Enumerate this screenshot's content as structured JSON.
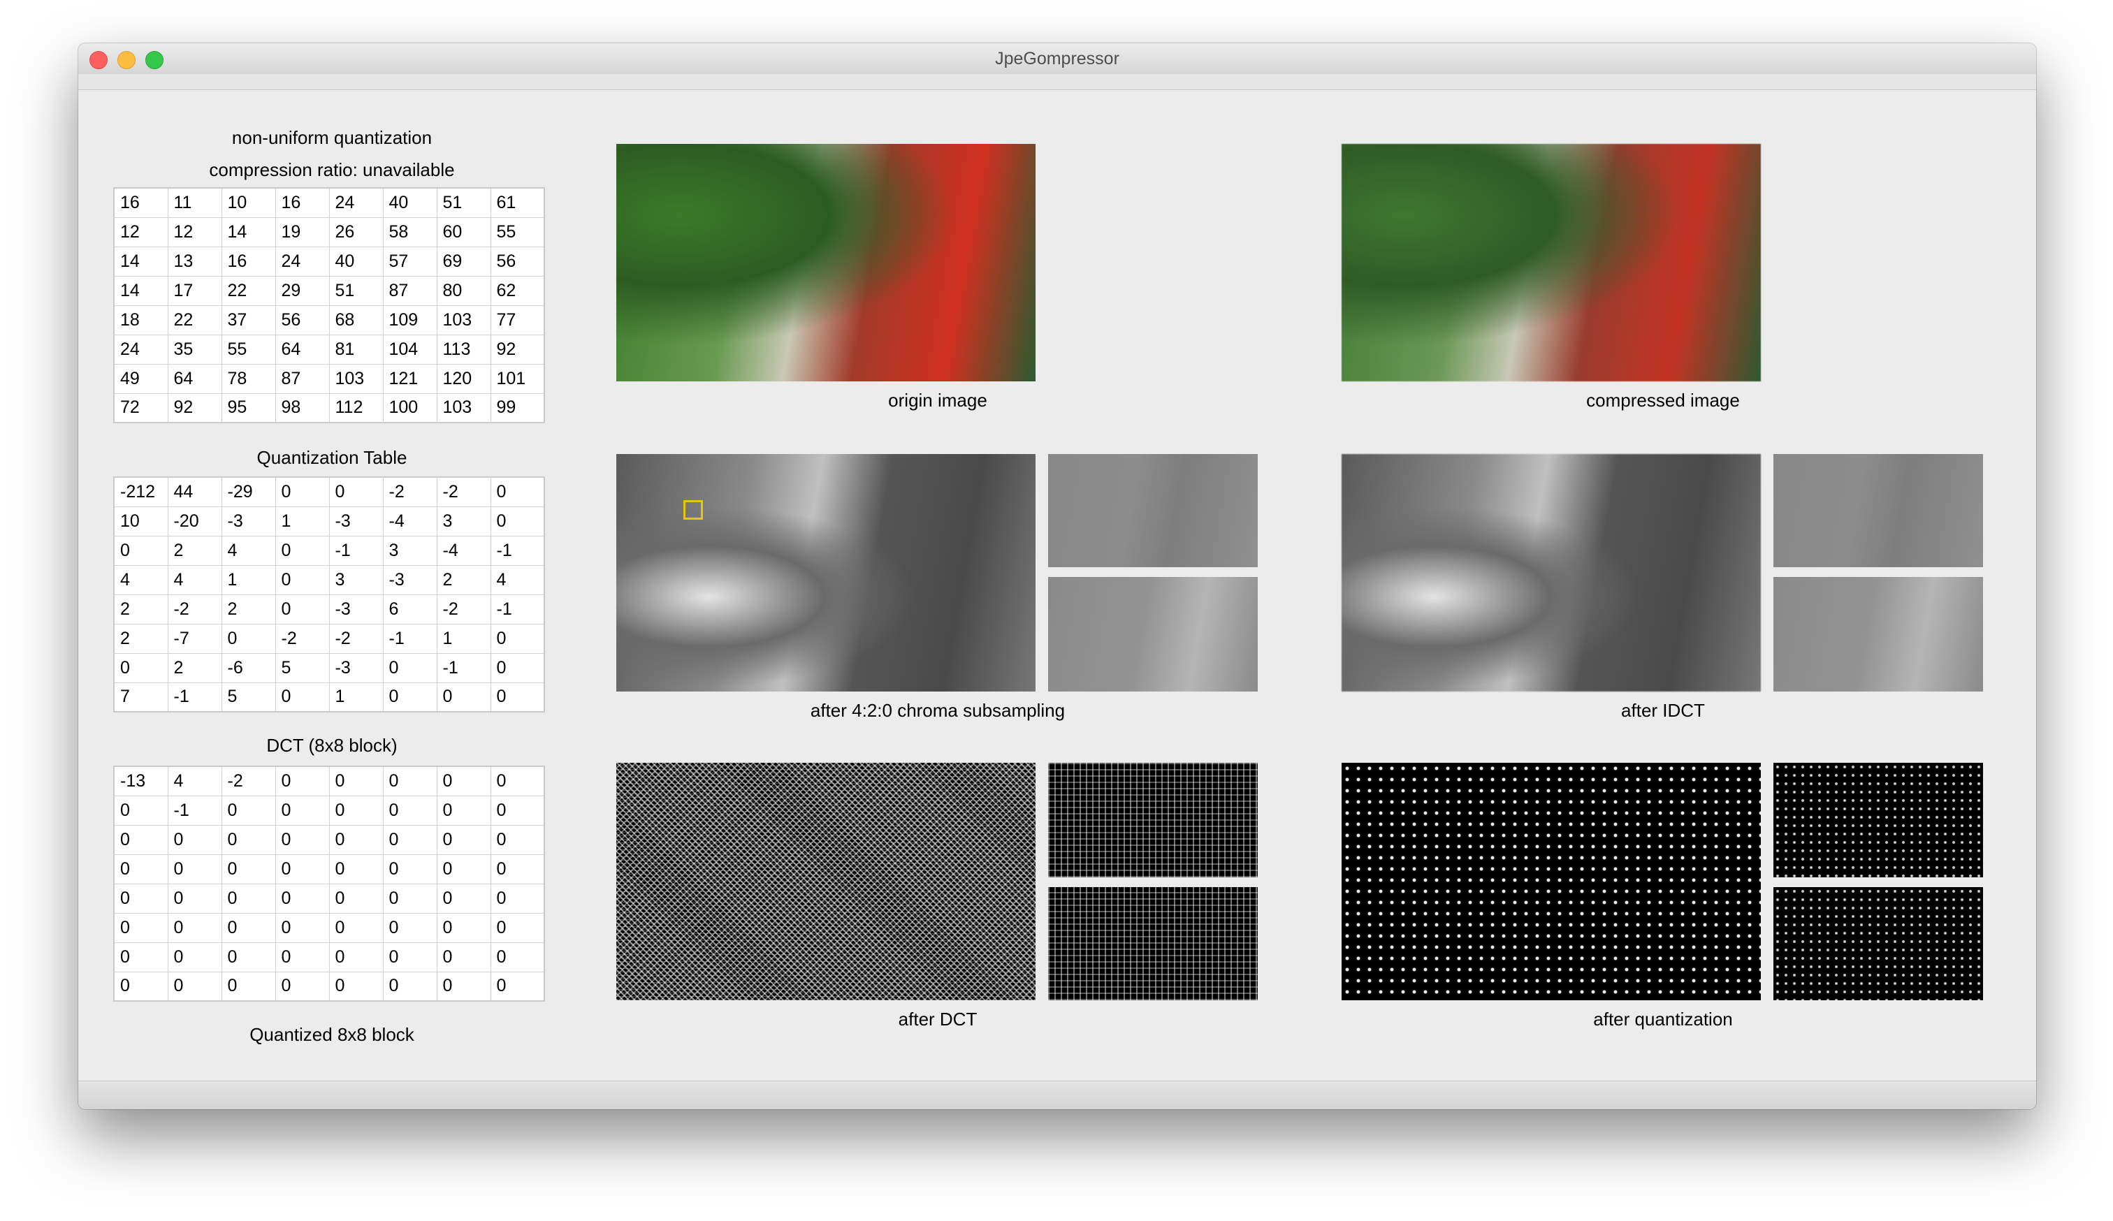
{
  "window": {
    "title": "JpeGompressor"
  },
  "left_panel": {
    "mode_label": "non-uniform quantization",
    "ratio_label": "compression ratio: unavailable",
    "quant_table_caption": "Quantization Table",
    "dct_caption": "DCT (8x8 block)",
    "quantized_caption": "Quantized 8x8 block",
    "quant_table": [
      [
        "16",
        "11",
        "10",
        "16",
        "24",
        "40",
        "51",
        "61"
      ],
      [
        "12",
        "12",
        "14",
        "19",
        "26",
        "58",
        "60",
        "55"
      ],
      [
        "14",
        "13",
        "16",
        "24",
        "40",
        "57",
        "69",
        "56"
      ],
      [
        "14",
        "17",
        "22",
        "29",
        "51",
        "87",
        "80",
        "62"
      ],
      [
        "18",
        "22",
        "37",
        "56",
        "68",
        "109",
        "103",
        "77"
      ],
      [
        "24",
        "35",
        "55",
        "64",
        "81",
        "104",
        "113",
        "92"
      ],
      [
        "49",
        "64",
        "78",
        "87",
        "103",
        "121",
        "120",
        "101"
      ],
      [
        "72",
        "92",
        "95",
        "98",
        "112",
        "100",
        "103",
        "99"
      ]
    ],
    "dct_block": [
      [
        "-212",
        "44",
        "-29",
        "0",
        "0",
        "-2",
        "-2",
        "0"
      ],
      [
        "10",
        "-20",
        "-3",
        "1",
        "-3",
        "-4",
        "3",
        "0"
      ],
      [
        "0",
        "2",
        "4",
        "0",
        "-1",
        "3",
        "-4",
        "-1"
      ],
      [
        "4",
        "4",
        "1",
        "0",
        "3",
        "-3",
        "2",
        "4"
      ],
      [
        "2",
        "-2",
        "2",
        "0",
        "-3",
        "6",
        "-2",
        "-1"
      ],
      [
        "2",
        "-7",
        "0",
        "-2",
        "-2",
        "-1",
        "1",
        "0"
      ],
      [
        "0",
        "2",
        "-6",
        "5",
        "-3",
        "0",
        "-1",
        "0"
      ],
      [
        "7",
        "-1",
        "5",
        "0",
        "1",
        "0",
        "0",
        "0"
      ]
    ],
    "quantized_block": [
      [
        "-13",
        "4",
        "-2",
        "0",
        "0",
        "0",
        "0",
        "0"
      ],
      [
        "0",
        "-1",
        "0",
        "0",
        "0",
        "0",
        "0",
        "0"
      ],
      [
        "0",
        "0",
        "0",
        "0",
        "0",
        "0",
        "0",
        "0"
      ],
      [
        "0",
        "0",
        "0",
        "0",
        "0",
        "0",
        "0",
        "0"
      ],
      [
        "0",
        "0",
        "0",
        "0",
        "0",
        "0",
        "0",
        "0"
      ],
      [
        "0",
        "0",
        "0",
        "0",
        "0",
        "0",
        "0",
        "0"
      ],
      [
        "0",
        "0",
        "0",
        "0",
        "0",
        "0",
        "0",
        "0"
      ],
      [
        "0",
        "0",
        "0",
        "0",
        "0",
        "0",
        "0",
        "0"
      ]
    ]
  },
  "panels": {
    "origin_caption": "origin image",
    "compressed_caption": "compressed image",
    "subsampling_caption": "after 4:2:0 chroma subsampling",
    "idct_caption": "after IDCT",
    "dct_caption": "after DCT",
    "quantization_caption": "after quantization"
  }
}
